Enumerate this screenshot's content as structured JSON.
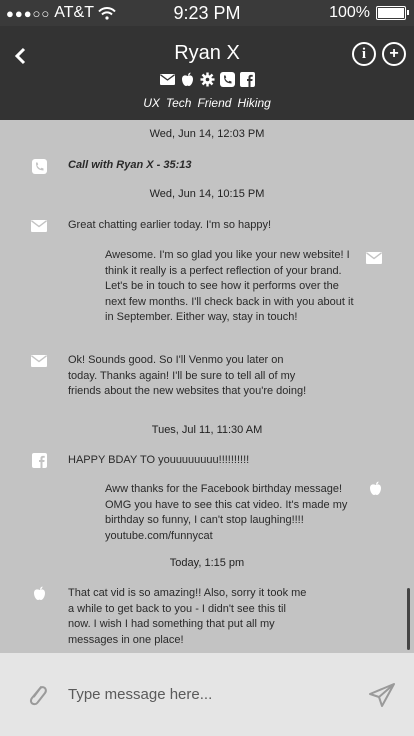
{
  "status": {
    "carrier": "AT&T",
    "time": "9:23 PM",
    "battery": "100%"
  },
  "header": {
    "name": "Ryan X",
    "tags": [
      "UX",
      "Tech",
      "Friend",
      "Hiking"
    ]
  },
  "feed": {
    "ts1": "Wed, Jun 14, 12:03 PM",
    "call": "Call with Ryan X - 35:13",
    "ts2": "Wed, Jun 14, 10:15 PM",
    "m1": "Great chatting earlier today. I'm so happy!",
    "m2": "Awesome. I'm so glad you like your new website! I think it really is a perfect reflection of your brand. Let's be in touch to see how it performs over the next few months. I'll check back in with you about it in September. Either way, stay in touch!",
    "m3": "Ok! Sounds good. So I'll Venmo you later on today. Thanks again! I'll be sure to tell all of my friends about the new websites that you're doing!",
    "ts3": "Tues, Jul 11, 11:30 AM",
    "m4": "HAPPY BDAY TO youuuuuuuu!!!!!!!!!!",
    "m5": "Aww thanks for the Facebook birthday message! OMG you have to see this cat video. It's made my birthday so funny, I can't stop laughing!!!! youtube.com/funnycat",
    "ts4": "Today, 1:15 pm",
    "m6": "That cat vid is so amazing!! Also, sorry it took me a while to get back to you - I didn't see this til now. I wish I had something that put all my messages in one place!"
  },
  "composer": {
    "placeholder": "Type message here..."
  }
}
